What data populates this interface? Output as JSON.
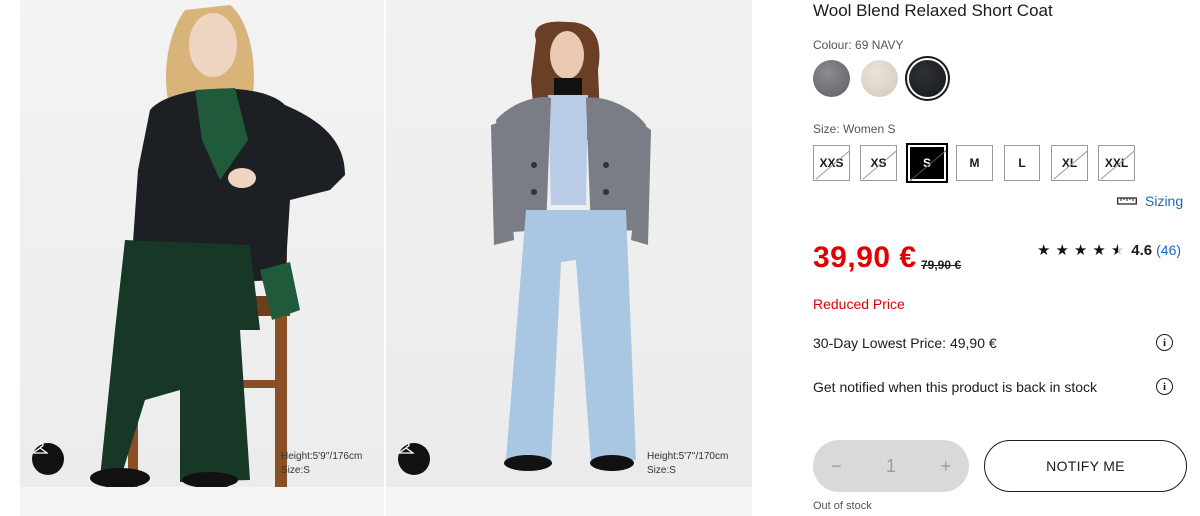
{
  "product": {
    "title": "Wool Blend Relaxed Short Coat",
    "colour_label": "Colour: 69 NAVY",
    "colours": [
      {
        "name": "gray",
        "hex": "#6e6f73"
      },
      {
        "name": "beige",
        "hex": "#ddd2c6"
      },
      {
        "name": "navy",
        "hex": "#1e2124",
        "selected": true
      }
    ],
    "size_label": "Size: Women S",
    "sizes": [
      {
        "label": "XXS",
        "available": false
      },
      {
        "label": "XS",
        "available": false
      },
      {
        "label": "S",
        "available": false,
        "selected": true
      },
      {
        "label": "M",
        "available": true
      },
      {
        "label": "L",
        "available": true
      },
      {
        "label": "XL",
        "available": false
      },
      {
        "label": "XXL",
        "available": false
      }
    ],
    "sizing_link": "Sizing",
    "sizing_icon": "ruler-icon",
    "price": "39,90 €",
    "old_price": "79,90 €",
    "rating_value": "4.6",
    "rating_count": "(46)",
    "rating_stars": 4.6,
    "reduced_label": "Reduced Price",
    "lowest_price": "30-Day Lowest Price: 49,90 €",
    "notify_info": "Get notified when this product is back in stock",
    "quantity": {
      "minus": "−",
      "value": "1",
      "plus": "+"
    },
    "notify_button": "NOTIFY ME",
    "stock_status": "Out of stock"
  },
  "images": [
    {
      "model_height": "Height:5'9''/176cm",
      "model_size": "Size:S",
      "icon": "hanger-icon"
    },
    {
      "model_height": "Height:5'7''/170cm",
      "model_size": "Size:S",
      "icon": "hanger-icon"
    }
  ],
  "colors": {
    "sale_red": "#e00000",
    "link_blue": "#1b64c8"
  }
}
